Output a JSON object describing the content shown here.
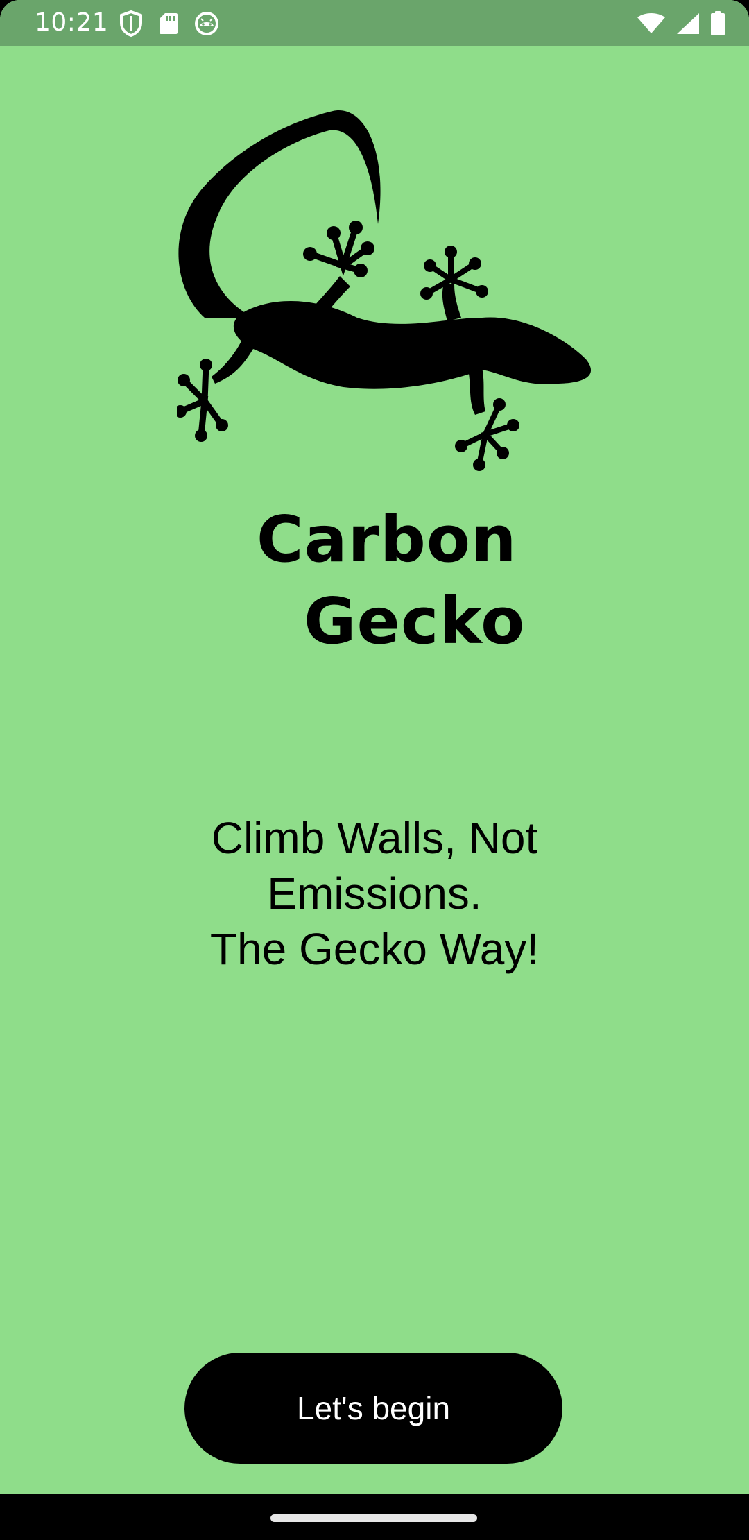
{
  "status_bar": {
    "time": "10:21",
    "left_icons": [
      "shield-icon",
      "sd-card-icon",
      "android-face-icon"
    ],
    "right_icons": [
      "wifi-icon",
      "cell-signal-icon",
      "battery-icon"
    ]
  },
  "app": {
    "title_line1": "Carbon",
    "title_line2": "Gecko",
    "logo": "gecko-silhouette"
  },
  "tagline": {
    "line1": "Climb Walls, Not",
    "line2": "Emissions.",
    "line3": "The Gecko Way!"
  },
  "actions": {
    "begin_label": "Let's begin"
  },
  "colors": {
    "background": "#8fdd8a",
    "status_bar": "#6aa56b",
    "button": "#000000",
    "button_text": "#ffffff"
  }
}
